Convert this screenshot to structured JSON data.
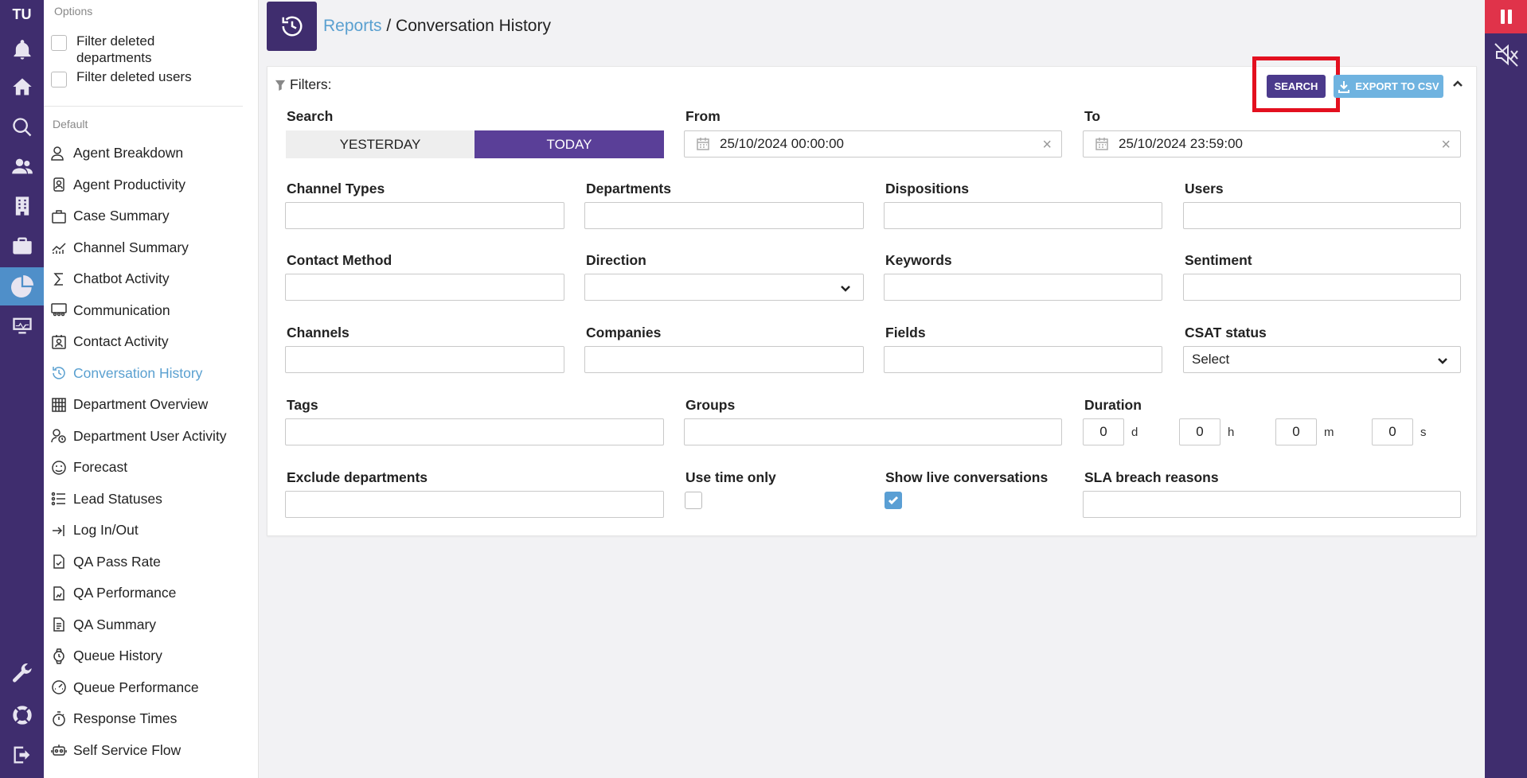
{
  "rail": {
    "initials": "TU",
    "icons": [
      "bell-icon",
      "home-icon",
      "search-icon",
      "users-icon",
      "building-icon",
      "briefcase-icon",
      "reports-icon",
      "monitor-icon",
      "wrench-icon",
      "support-icon",
      "logout-icon"
    ]
  },
  "menu": {
    "options_title": "Options",
    "filter_deleted_departments": "Filter deleted departments",
    "filter_deleted_users": "Filter deleted users",
    "default_title": "Default",
    "items": [
      {
        "label": "Agent Breakdown"
      },
      {
        "label": "Agent Productivity"
      },
      {
        "label": "Case Summary"
      },
      {
        "label": "Channel Summary"
      },
      {
        "label": "Chatbot Activity"
      },
      {
        "label": "Communication"
      },
      {
        "label": "Contact Activity"
      },
      {
        "label": "Conversation History"
      },
      {
        "label": "Department Overview"
      },
      {
        "label": "Department User Activity"
      },
      {
        "label": "Forecast"
      },
      {
        "label": "Lead Statuses"
      },
      {
        "label": "Log In/Out"
      },
      {
        "label": "QA Pass Rate"
      },
      {
        "label": "QA Performance"
      },
      {
        "label": "QA Summary"
      },
      {
        "label": "Queue History"
      },
      {
        "label": "Queue Performance"
      },
      {
        "label": "Response Times"
      },
      {
        "label": "Self Service Flow"
      }
    ],
    "active_item": "Conversation History"
  },
  "header": {
    "breadcrumb_link": "Reports",
    "separator": " / ",
    "page_title": "Conversation History"
  },
  "filters": {
    "title": "Filters:",
    "search_button": "SEARCH",
    "export_button": "EXPORT TO CSV",
    "search_label": "Search",
    "yesterday": "YESTERDAY",
    "today": "TODAY",
    "selected_range": "TODAY",
    "from_label": "From",
    "from_value": "25/10/2024 00:00:00",
    "to_label": "To",
    "to_value": "25/10/2024 23:59:00",
    "channel_types": "Channel Types",
    "departments": "Departments",
    "dispositions": "Dispositions",
    "users": "Users",
    "contact_method": "Contact Method",
    "direction": "Direction",
    "keywords": "Keywords",
    "sentiment": "Sentiment",
    "channels": "Channels",
    "companies": "Companies",
    "fields": "Fields",
    "csat_status": "CSAT status",
    "csat_value": "Select",
    "tags": "Tags",
    "groups": "Groups",
    "duration": "Duration",
    "duration_values": {
      "d": "0",
      "h": "0",
      "m": "0",
      "s": "0"
    },
    "duration_units": {
      "d": "d",
      "h": "h",
      "m": "m",
      "s": "s"
    },
    "exclude_departments": "Exclude departments",
    "use_time_only": "Use time only",
    "use_time_only_checked": false,
    "show_live_conversations": "Show live conversations",
    "show_live_checked": true,
    "sla_breach_reasons": "SLA breach reasons"
  },
  "colors": {
    "brand_purple": "#3f2d6e",
    "accent_purple": "#5a3f98",
    "link_blue": "#5aa0d0",
    "highlight_red": "#e3101f"
  }
}
